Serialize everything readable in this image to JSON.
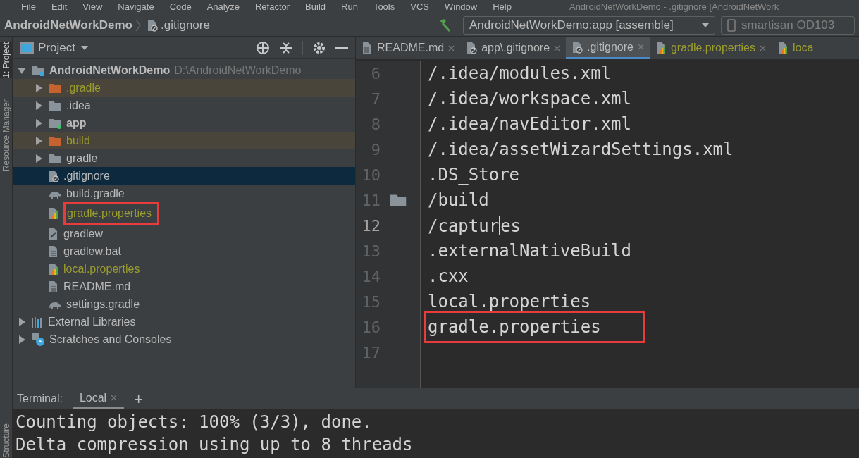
{
  "menu_bar": {
    "items": [
      "File",
      "Edit",
      "View",
      "Navigate",
      "Code",
      "Analyze",
      "Refactor",
      "Build",
      "Run",
      "Tools",
      "VCS",
      "Window",
      "Help"
    ],
    "title": "AndroidNetWorkDemo - .gitignore [AndroidNetWork"
  },
  "navigation_bar": {
    "breadcrumbs": [
      {
        "label": "AndroidNetWorkDemo",
        "kind": "project"
      },
      {
        "label": ".gitignore",
        "kind": "ignore"
      }
    ],
    "run_config": "AndroidNetWorkDemo:app [assemble]",
    "device": "smartisan OD103"
  },
  "tool_stripe": [
    {
      "label": "1: Project",
      "selected": true
    },
    {
      "label": "Resource Manager",
      "selected": false
    },
    {
      "label": "Structure",
      "selected": false
    }
  ],
  "project_panel": {
    "title": "Project",
    "tree": [
      {
        "label": "AndroidNetWorkDemo",
        "path": "D:\\AndroidNetWorkDemo",
        "kind": "module",
        "expanded": true,
        "bold": true,
        "excluded": false,
        "selected": false,
        "highlighted": false,
        "ignored": false,
        "children": [
          {
            "label": ".gradle",
            "kind": "excluded",
            "expanded": false,
            "bold": false,
            "excluded": true,
            "selected": false,
            "highlighted": false,
            "ignored": true
          },
          {
            "label": ".idea",
            "kind": "folder",
            "expanded": false,
            "bold": false,
            "excluded": false,
            "selected": false,
            "highlighted": false,
            "ignored": false
          },
          {
            "label": "app",
            "kind": "appmodule",
            "expanded": false,
            "bold": true,
            "excluded": false,
            "selected": false,
            "highlighted": false,
            "ignored": false
          },
          {
            "label": "build",
            "kind": "excluded",
            "expanded": false,
            "bold": false,
            "excluded": true,
            "selected": false,
            "highlighted": false,
            "ignored": true
          },
          {
            "label": "gradle",
            "kind": "folder",
            "expanded": false,
            "bold": false,
            "excluded": false,
            "selected": false,
            "highlighted": false,
            "ignored": false
          },
          {
            "label": ".gitignore",
            "kind": "ignore",
            "bold": false,
            "excluded": false,
            "selected": true,
            "highlighted": false,
            "ignored": false
          },
          {
            "label": "build.gradle",
            "kind": "gradle",
            "bold": false,
            "excluded": false,
            "selected": false,
            "highlighted": false,
            "ignored": false
          },
          {
            "label": "gradle.properties",
            "kind": "properties",
            "bold": false,
            "excluded": false,
            "selected": false,
            "highlighted": true,
            "ignored": true
          },
          {
            "label": "gradlew",
            "kind": "script",
            "bold": false,
            "excluded": false,
            "selected": false,
            "highlighted": false,
            "ignored": false
          },
          {
            "label": "gradlew.bat",
            "kind": "text",
            "bold": false,
            "excluded": false,
            "selected": false,
            "highlighted": false,
            "ignored": false
          },
          {
            "label": "local.properties",
            "kind": "properties",
            "bold": false,
            "excluded": false,
            "selected": false,
            "highlighted": false,
            "ignored": true
          },
          {
            "label": "README.md",
            "kind": "text",
            "bold": false,
            "excluded": false,
            "selected": false,
            "highlighted": false,
            "ignored": false
          },
          {
            "label": "settings.gradle",
            "kind": "gradle",
            "bold": false,
            "excluded": false,
            "selected": false,
            "highlighted": false,
            "ignored": false
          }
        ]
      },
      {
        "label": "External Libraries",
        "kind": "libraries",
        "expanded": false,
        "bold": false,
        "excluded": false,
        "selected": false,
        "highlighted": false,
        "ignored": false
      },
      {
        "label": "Scratches and Consoles",
        "kind": "scratches",
        "expanded": false,
        "bold": false,
        "excluded": false,
        "selected": false,
        "highlighted": false,
        "ignored": false
      }
    ]
  },
  "editor_tabs": [
    {
      "label": "README.md",
      "kind": "text",
      "selected": false,
      "ignored": false,
      "closable": true
    },
    {
      "label": "app\\.gitignore",
      "kind": "ignore",
      "selected": false,
      "ignored": false,
      "closable": true
    },
    {
      "label": ".gitignore",
      "kind": "ignore",
      "selected": true,
      "ignored": false,
      "closable": true
    },
    {
      "label": "gradle.properties",
      "kind": "properties",
      "selected": false,
      "ignored": true,
      "closable": true
    },
    {
      "label": "loca",
      "kind": "properties",
      "selected": false,
      "ignored": true,
      "closable": false
    }
  ],
  "editor": {
    "lines": [
      {
        "number": "6",
        "text": "/.idea/modules.xml",
        "current": false,
        "highlighted": false,
        "fold": false
      },
      {
        "number": "7",
        "text": "/.idea/workspace.xml",
        "current": false,
        "highlighted": false,
        "fold": false
      },
      {
        "number": "8",
        "text": "/.idea/navEditor.xml",
        "current": false,
        "highlighted": false,
        "fold": false
      },
      {
        "number": "9",
        "text": "/.idea/assetWizardSettings.xml",
        "current": false,
        "highlighted": false,
        "fold": false
      },
      {
        "number": "10",
        "text": ".DS_Store",
        "current": false,
        "highlighted": false,
        "fold": false
      },
      {
        "number": "11",
        "text": "/build",
        "current": false,
        "highlighted": false,
        "fold": true
      },
      {
        "number": "12",
        "text": "/captur",
        "text_after_cursor": "es",
        "current": true,
        "highlighted": false,
        "fold": false
      },
      {
        "number": "13",
        "text": ".externalNativeBuild",
        "current": false,
        "highlighted": false,
        "fold": false
      },
      {
        "number": "14",
        "text": ".cxx",
        "current": false,
        "highlighted": false,
        "fold": false
      },
      {
        "number": "15",
        "text": "local.properties",
        "current": false,
        "highlighted": false,
        "fold": false
      },
      {
        "number": "16",
        "text": "gradle.properties",
        "current": false,
        "highlighted": true,
        "fold": false
      },
      {
        "number": "17",
        "current": false,
        "highlighted": false,
        "fold": false
      }
    ]
  },
  "terminal": {
    "label": "Terminal:",
    "tabs": [
      {
        "label": "Local",
        "selected": true
      }
    ],
    "add": "+",
    "lines": [
      "Counting objects: 100% (3/3), done.",
      "Delta compression using up to 8 threads"
    ]
  }
}
